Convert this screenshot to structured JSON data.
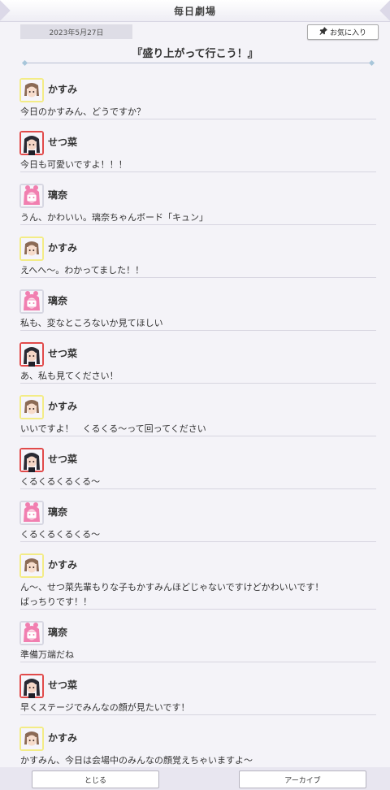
{
  "header": {
    "title": "毎日劇場"
  },
  "date": "2023年5月27日",
  "favorite": {
    "label": "お気に入り",
    "icon": "pin-icon"
  },
  "episode_title": "『盛り上がって行こう！』",
  "characters": {
    "kasumi": {
      "name": "かすみ",
      "frame": "#f3ec86",
      "hair": "#8b6a55",
      "skin": "#f7dccb"
    },
    "setsuna": {
      "name": "せつ菜",
      "frame": "#e14a4a",
      "hair": "#2a2a33",
      "skin": "#f5d6c6"
    },
    "rina": {
      "name": "璃奈",
      "frame": "#d7d7e2",
      "hair": "#f17fb0",
      "skin": "#fce7ef"
    }
  },
  "lines": [
    {
      "speaker": "かすみ",
      "text": "今日のかすみん、どうですか？"
    },
    {
      "speaker": "せつ菜",
      "text": "今日も可愛いですよ！！！"
    },
    {
      "speaker": "璃奈",
      "text": "うん、かわいい。璃奈ちゃんボード「キュン」"
    },
    {
      "speaker": "かすみ",
      "text": "えへへ～。わかってました！！"
    },
    {
      "speaker": "璃奈",
      "text": "私も、変なところないか見てほしい"
    },
    {
      "speaker": "せつ菜",
      "text": "あ、私も見てください！"
    },
    {
      "speaker": "かすみ",
      "text": "いいですよ！　くるくる～って回ってください"
    },
    {
      "speaker": "せつ菜",
      "text": "くるくるくるくる～"
    },
    {
      "speaker": "璃奈",
      "text": "くるくるくるくる～"
    },
    {
      "speaker": "かすみ",
      "text": "ん～、せつ菜先輩もりな子もかすみんほどじゃないですけどかわいいです！\nばっちりです！！"
    },
    {
      "speaker": "璃奈",
      "text": "準備万端だね"
    },
    {
      "speaker": "せつ菜",
      "text": "早くステージでみんなの顔が見たいです！"
    },
    {
      "speaker": "かすみ",
      "text": "かすみん、今日は会場中のみんなの顔覚えちゃいますよ～"
    }
  ],
  "footer": {
    "close_label": "とじる",
    "archive_label": "アーカイブ"
  }
}
